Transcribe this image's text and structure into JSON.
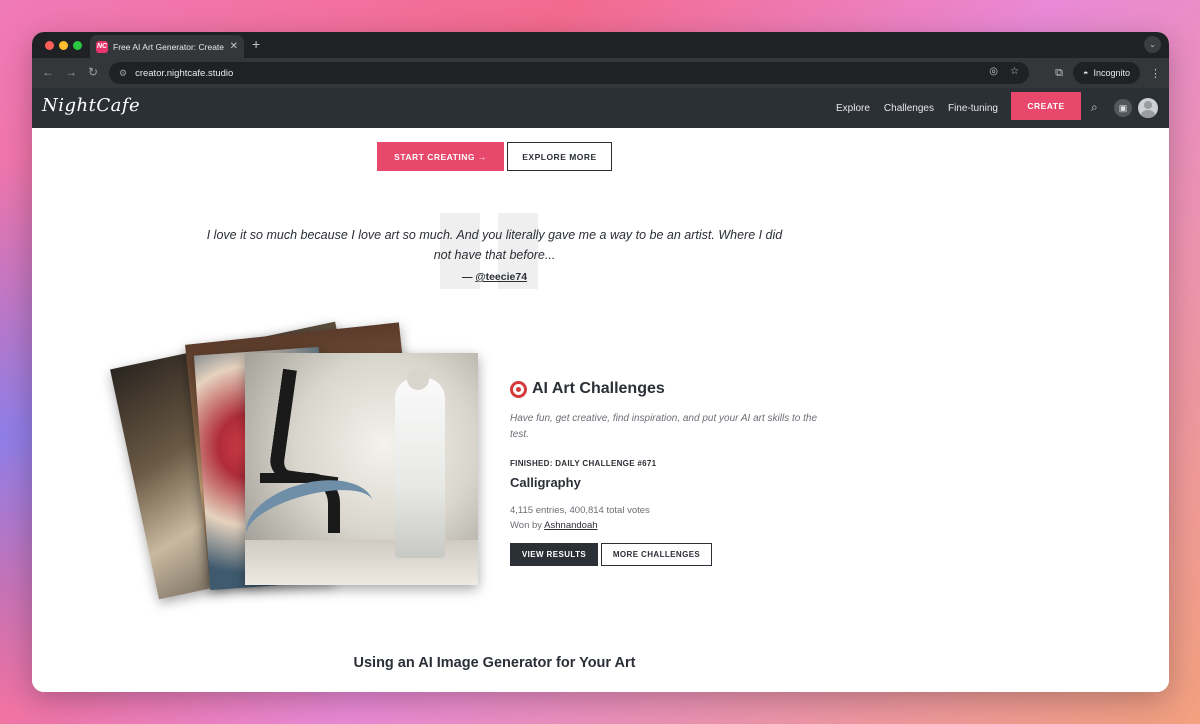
{
  "browser": {
    "tab_title": "Free AI Art Generator: Create",
    "favicon_label": "NC",
    "url": "creator.nightcafe.studio",
    "incognito_label": "Incognito"
  },
  "site": {
    "logo": "NightCafe",
    "nav": [
      "Explore",
      "Challenges",
      "Fine-tuning"
    ],
    "create_label": "CREATE"
  },
  "hero": {
    "start_label": "START CREATING →",
    "explore_label": "EXPLORE MORE"
  },
  "testimonial": {
    "text": "I love it so much because I love art so much. And you literally gave me a way to be an artist. Where I did not have that before...",
    "dash": "—",
    "author": "@teecie74"
  },
  "challenge": {
    "title": "AI Art Challenges",
    "description": "Have fun, get creative, find inspiration, and put your AI art skills to the test.",
    "status_label": "FINISHED: DAILY CHALLENGE #671",
    "name": "Calligraphy",
    "stats": "4,115 entries, 400,814 total votes",
    "won_by_prefix": "Won by",
    "winner": "Ashnandoah",
    "results_label": "VIEW RESULTS",
    "more_label": "MORE CHALLENGES"
  },
  "next_section_title": "Using an AI Image Generator for Your Art",
  "colors": {
    "accent": "#e8486b",
    "dark": "#2b2f36"
  }
}
